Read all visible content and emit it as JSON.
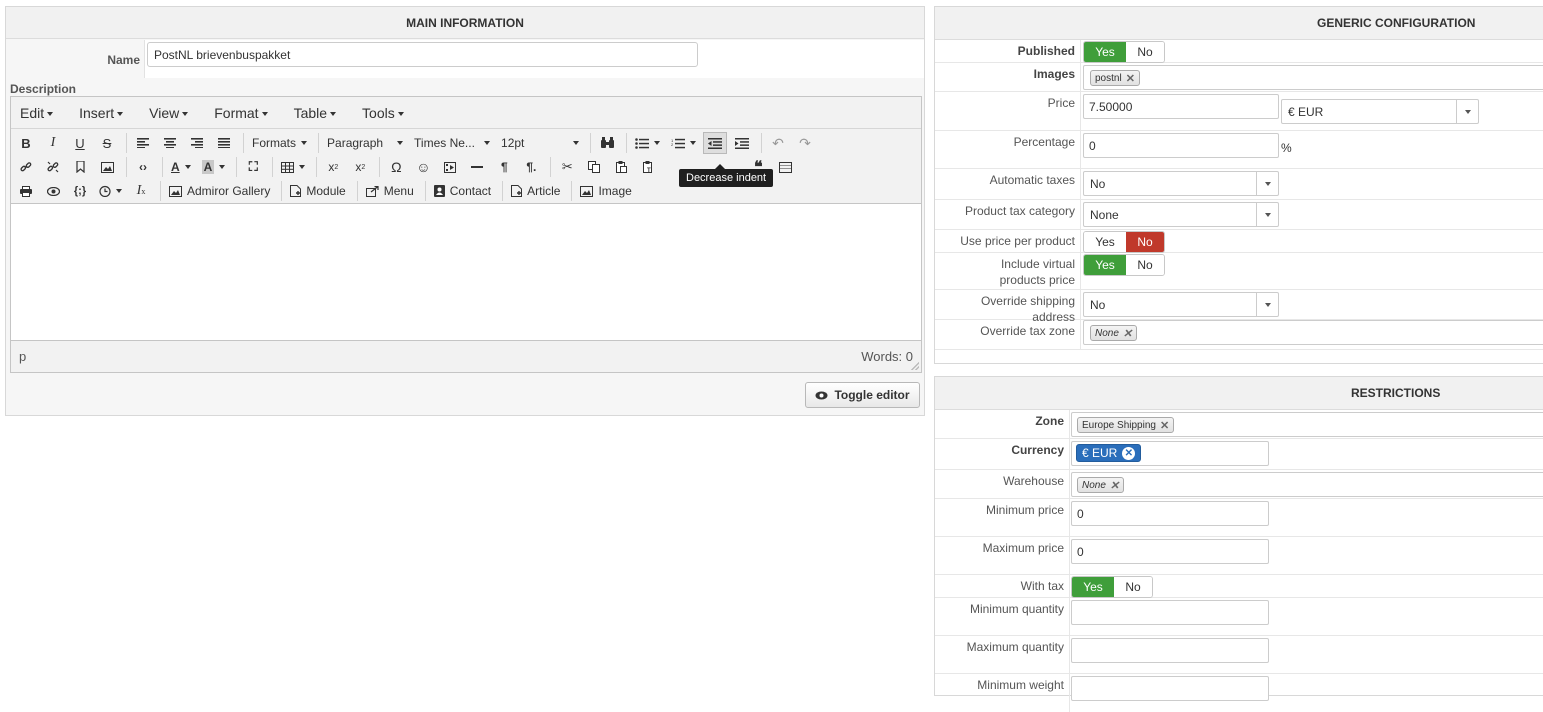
{
  "main": {
    "title": "MAIN INFORMATION",
    "name_label": "Name",
    "name_value": "PostNL brievenbuspakket",
    "description_label": "Description",
    "menu": [
      "Edit",
      "Insert",
      "View",
      "Format",
      "Table",
      "Tools"
    ],
    "toolbar": {
      "formats": "Formats",
      "paragraph": "Paragraph",
      "font": "Times Ne...",
      "size": "12pt",
      "tooltip": "Decrease indent",
      "admiror": "Admiror Gallery",
      "module": "Module",
      "menu": "Menu",
      "contact": "Contact",
      "article": "Article",
      "image": "Image"
    },
    "status_path": "p",
    "words": "Words: 0",
    "toggle_editor": "Toggle editor"
  },
  "config": {
    "title": "GENERIC CONFIGURATION",
    "published_label": "Published",
    "images_label": "Images",
    "images_tag": "postnl",
    "price_label": "Price",
    "price_value": "7.50000",
    "currency_value": "€ EUR",
    "percentage_label": "Percentage",
    "percentage_value": "0",
    "percent_sign": "%",
    "auto_taxes_label": "Automatic taxes",
    "auto_taxes_value": "No",
    "tax_category_label": "Product tax category",
    "tax_category_value": "None",
    "price_per_product_label": "Use price per product",
    "include_virtual_label_1": "Include virtual",
    "include_virtual_label_2": "products price",
    "override_shipping_label": "Override shipping address",
    "override_shipping_value": "No",
    "override_tax_zone_label": "Override tax zone",
    "override_tax_zone_tag": "None",
    "yes": "Yes",
    "no": "No"
  },
  "restrict": {
    "title": "RESTRICTIONS",
    "zone_label": "Zone",
    "zone_tag": "Europe Shipping",
    "currency_label": "Currency",
    "currency_tag": "€ EUR",
    "warehouse_label": "Warehouse",
    "warehouse_tag": "None",
    "min_price_label": "Minimum price",
    "min_price_value": "0",
    "max_price_label": "Maximum price",
    "max_price_value": "0",
    "with_tax_label": "With tax",
    "min_qty_label": "Minimum quantity",
    "max_qty_label": "Maximum quantity",
    "min_weight_label": "Minimum weight",
    "yes": "Yes",
    "no": "No"
  }
}
